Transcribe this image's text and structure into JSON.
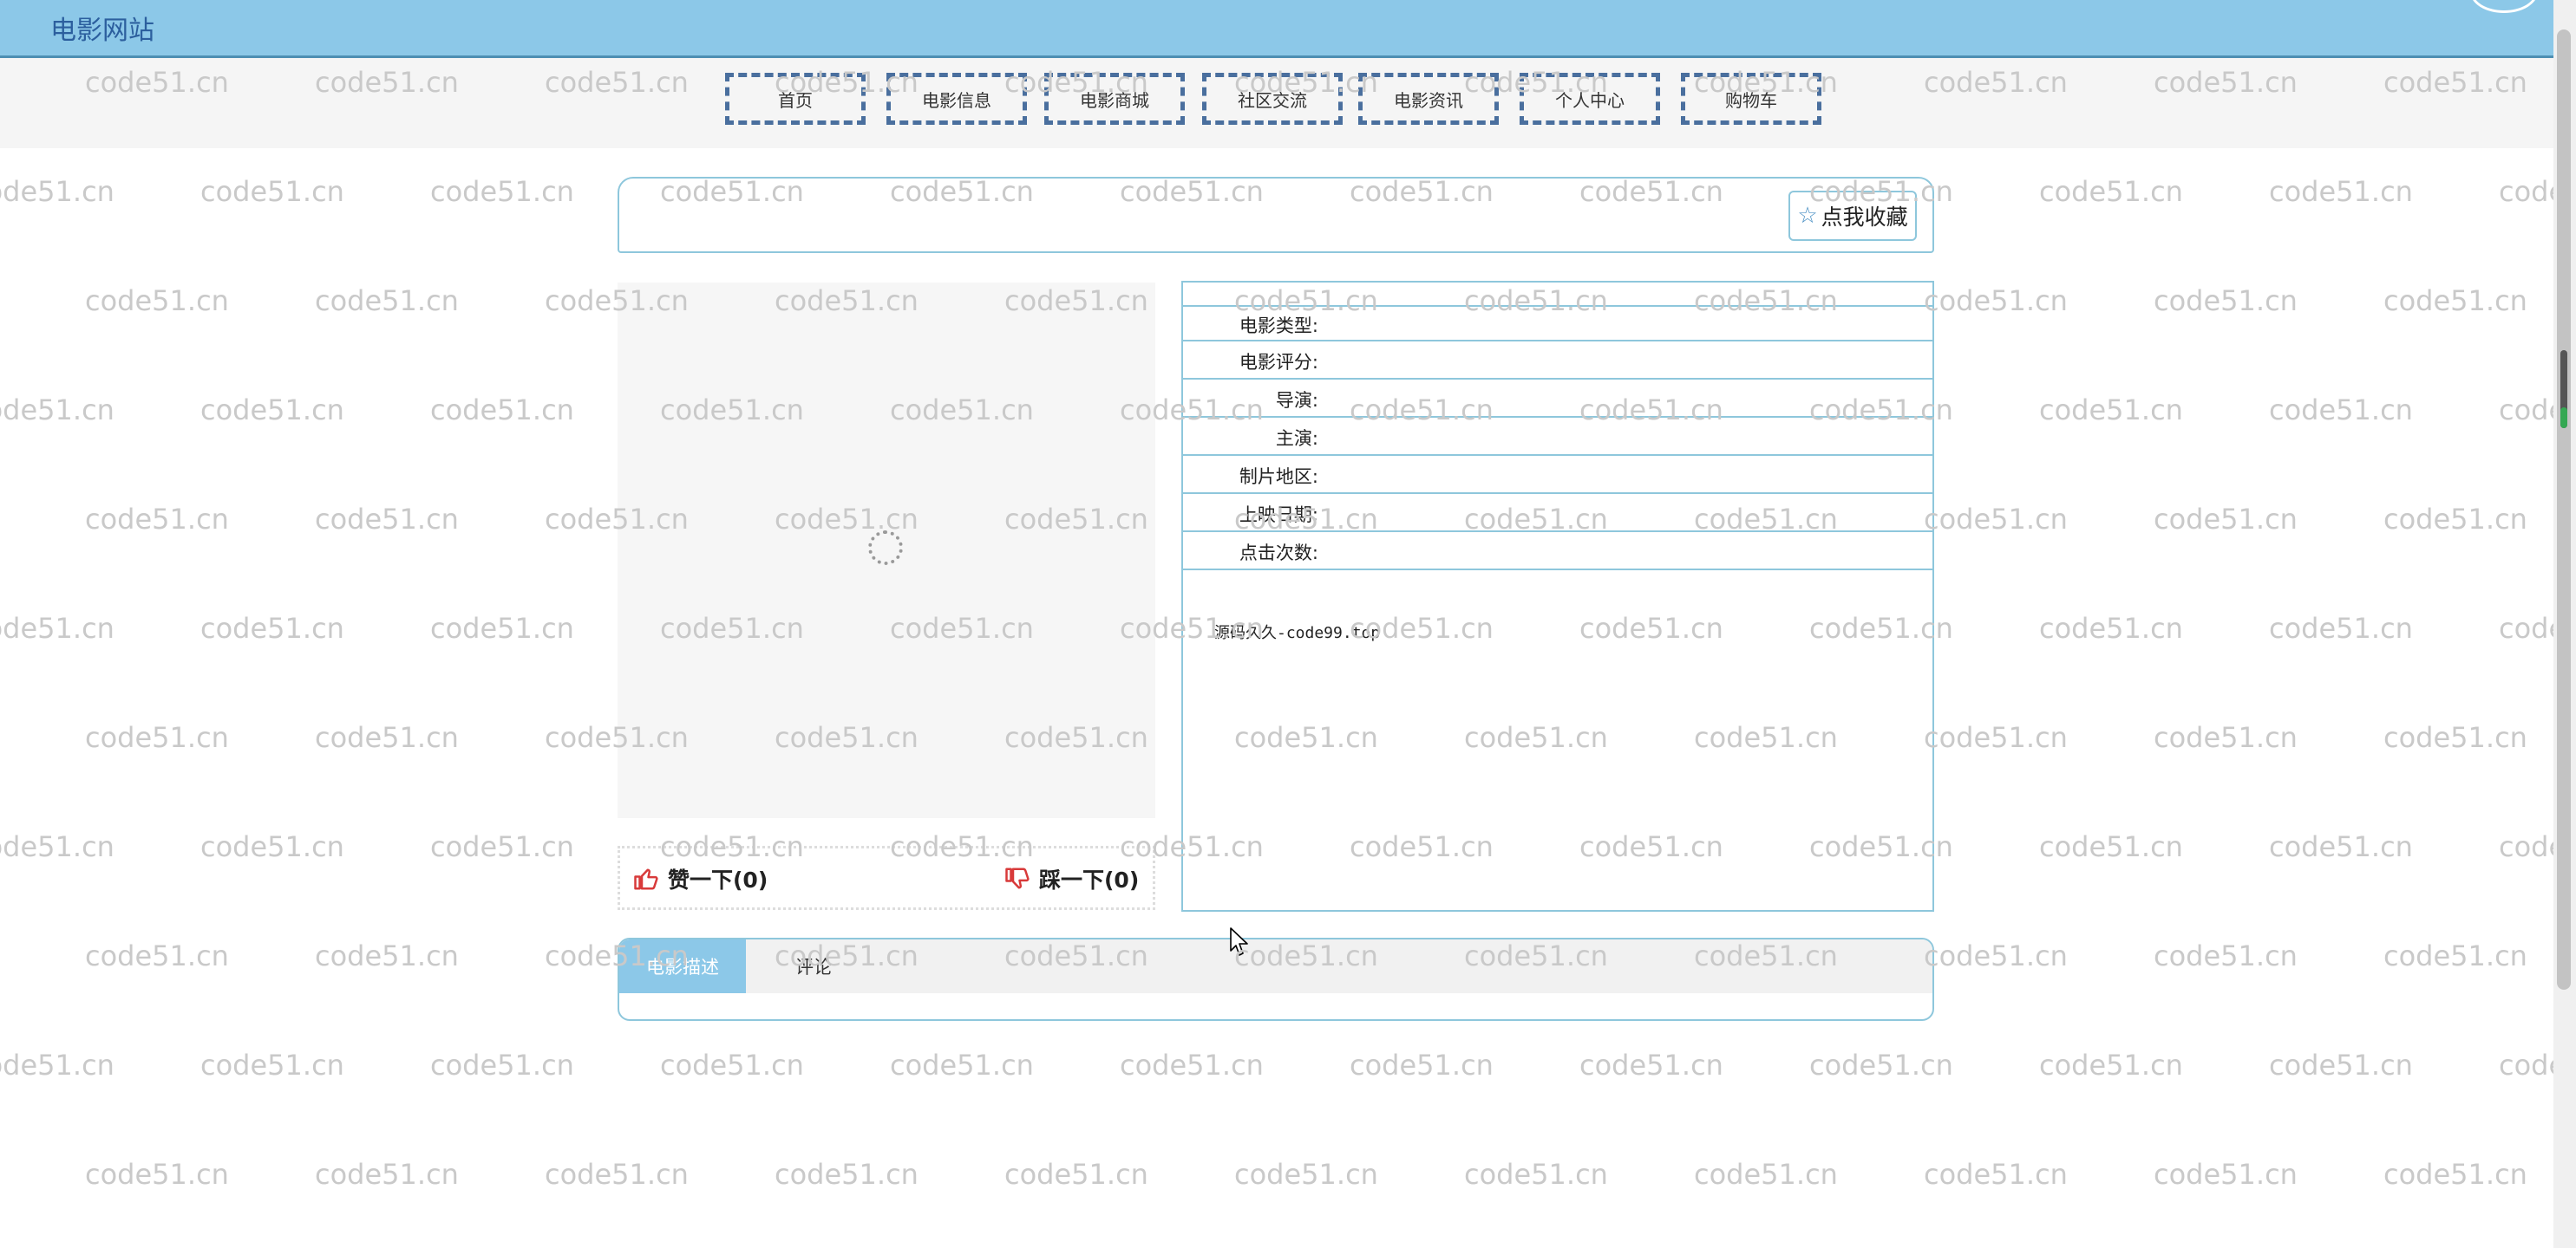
{
  "header": {
    "site_title": "电影网站"
  },
  "nav": {
    "items": [
      {
        "label": "首页"
      },
      {
        "label": "电影信息"
      },
      {
        "label": "电影商城"
      },
      {
        "label": "社区交流"
      },
      {
        "label": "电影资讯"
      },
      {
        "label": "个人中心"
      },
      {
        "label": "购物车"
      }
    ]
  },
  "favorite": {
    "label": "点我收藏",
    "icon": "star-icon"
  },
  "votes": {
    "like_label": "赞一下(0)",
    "dislike_label": "踩一下(0)"
  },
  "info": {
    "rows": [
      {
        "label": "电影类型:"
      },
      {
        "label": "电影评分:"
      },
      {
        "label": "导演:"
      },
      {
        "label": "主演:"
      },
      {
        "label": "制片地区:"
      },
      {
        "label": "上映日期:"
      },
      {
        "label": "点击次数:"
      }
    ],
    "description": "源码久久-code99.top"
  },
  "tabs": [
    {
      "label": "电影描述",
      "active": true
    },
    {
      "label": "评论",
      "active": false
    }
  ],
  "watermark": "code51.cn",
  "colors": {
    "header_bg": "#8cc8e8",
    "accent_border": "#8ec7dc",
    "nav_border": "#4a6f9e",
    "like_red": "#d83a3a"
  }
}
